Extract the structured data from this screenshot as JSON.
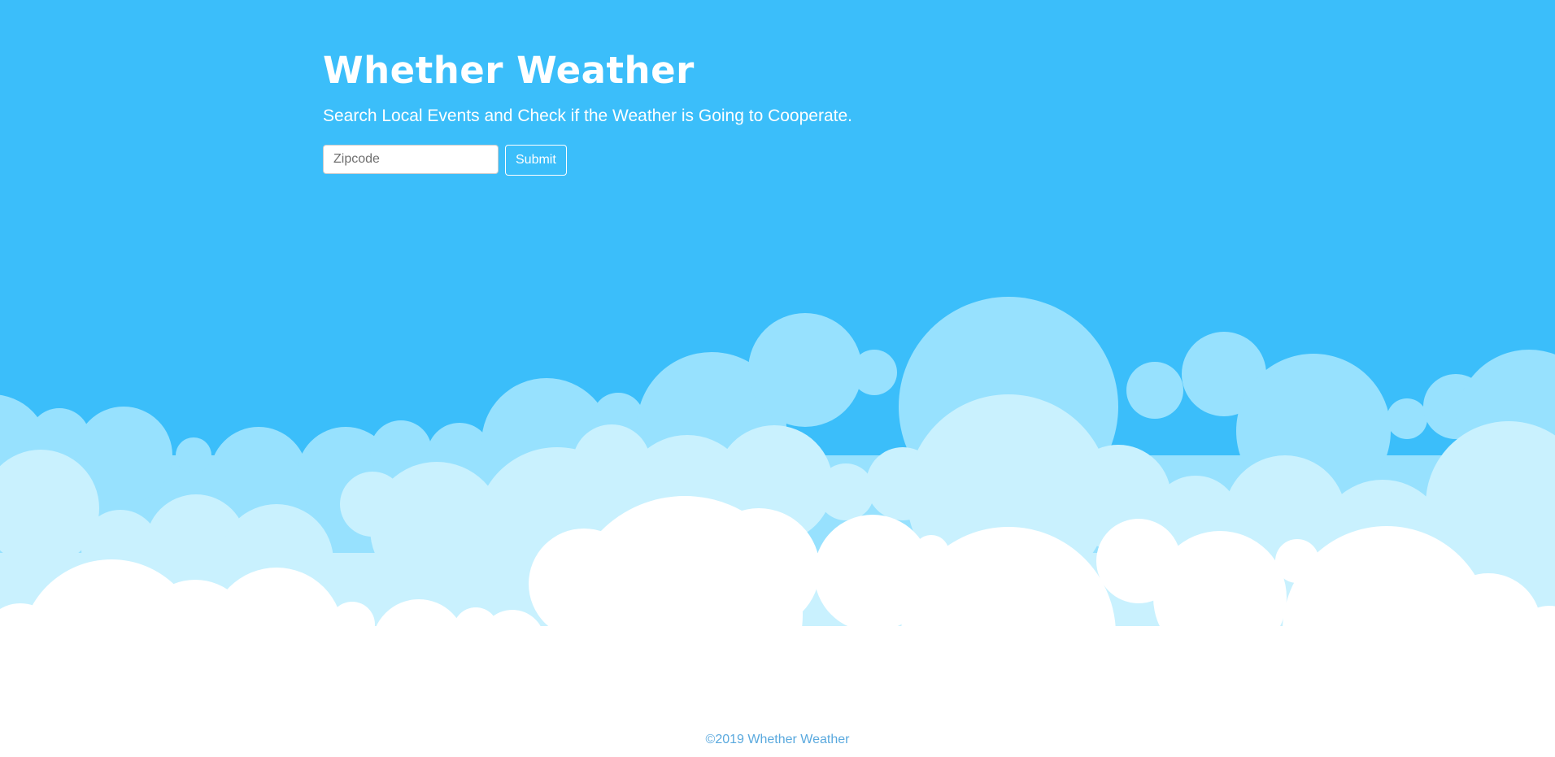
{
  "header": {
    "title": "Whether Weather",
    "subtitle": "Search Local Events and Check if the Weather is Going to Cooperate."
  },
  "search": {
    "placeholder": "Zipcode",
    "value": "",
    "submit_label": "Submit"
  },
  "footer": {
    "copyright": "©2019 Whether Weather"
  },
  "colors": {
    "sky": "#3bbefa",
    "cloud_back": "#97e1fe",
    "cloud_mid": "#c9f1fe",
    "cloud_front": "#ffffff",
    "footer_text": "#5aa9de"
  }
}
